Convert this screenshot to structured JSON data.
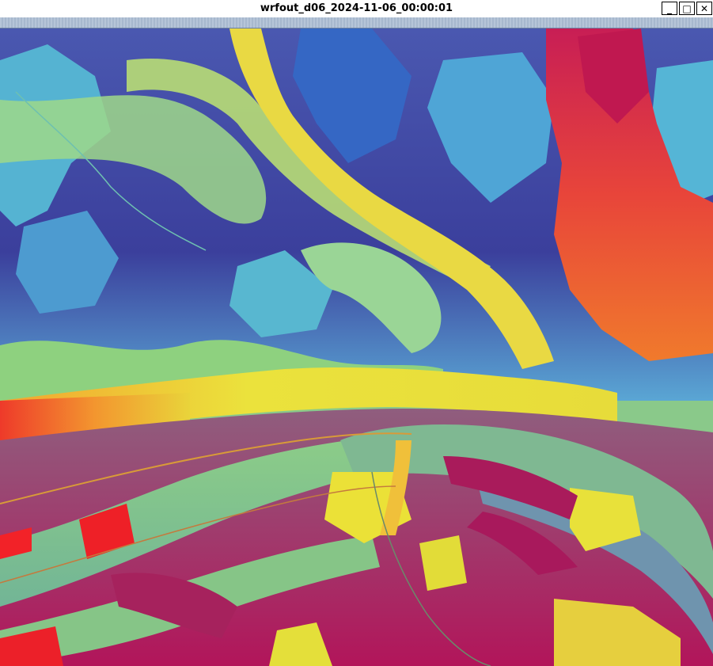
{
  "window": {
    "title": "wrfout_d06_2024-11-06_00:00:01",
    "buttons": {
      "minimize": "_",
      "maximize": "□",
      "close": "✕"
    }
  },
  "colors": {
    "deep_purple": "#3f3f9e",
    "blue": "#3b7fd0",
    "cyan": "#5fc2d4",
    "teal_green": "#7dcf9a",
    "green": "#8ac98a",
    "yellow": "#e9e43a",
    "orange": "#f29a32",
    "red": "#e6202a",
    "magenta": "#b0195a"
  },
  "plot": {
    "description_icon": "terrain-raster-field"
  }
}
